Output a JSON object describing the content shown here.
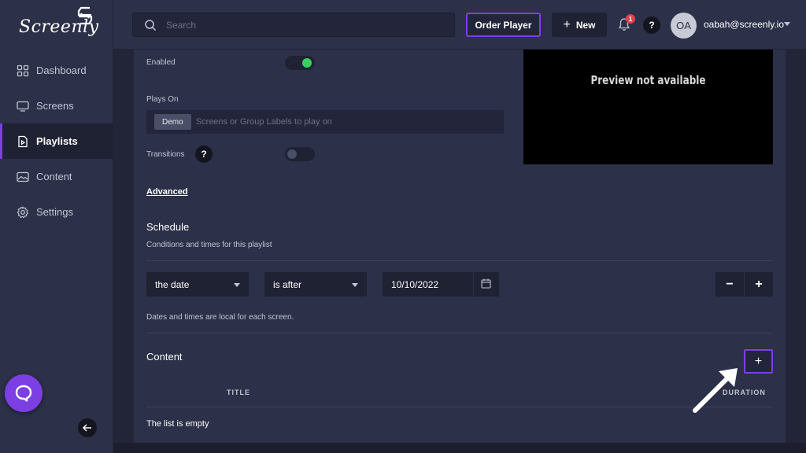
{
  "brand": {
    "name": "Screenly"
  },
  "sidebar": {
    "items": [
      {
        "label": "Dashboard",
        "icon": "dashboard-icon",
        "active": false
      },
      {
        "label": "Screens",
        "icon": "screen-icon",
        "active": false
      },
      {
        "label": "Playlists",
        "icon": "playlist-icon",
        "active": true
      },
      {
        "label": "Content",
        "icon": "image-icon",
        "active": false
      },
      {
        "label": "Settings",
        "icon": "gear-icon",
        "active": false
      }
    ]
  },
  "topbar": {
    "search_placeholder": "Search",
    "order_label": "Order Player",
    "new_plus": "+",
    "new_label": "New",
    "notification_count": "1",
    "help_label": "?",
    "avatar_initials": "OA",
    "user_email": "oabah@screenly.io"
  },
  "form": {
    "enabled_label": "Enabled",
    "enabled_value": true,
    "plays_on_label": "Plays On",
    "plays_on_chip": "Demo",
    "plays_on_placeholder": "Screens or Group Labels to play on",
    "transitions_label": "Transitions",
    "transitions_help": "?",
    "transitions_value": false,
    "advanced_label": "Advanced"
  },
  "preview": {
    "text": "Preview not available"
  },
  "schedule": {
    "title": "Schedule",
    "subtitle": "Conditions and times for this playlist",
    "field_value": "the date",
    "operator_value": "is after",
    "date_value": "10/10/2022",
    "minus_label": "−",
    "plus_label": "+",
    "note": "Dates and times are local for each screen."
  },
  "content": {
    "title": "Content",
    "add_label": "+",
    "col_title": "TITLE",
    "col_duration": "DURATION",
    "empty_text": "The list is empty"
  },
  "colors": {
    "accent": "#7b3fe4",
    "toggle_on": "#37d05e",
    "badge": "#e2414c"
  }
}
